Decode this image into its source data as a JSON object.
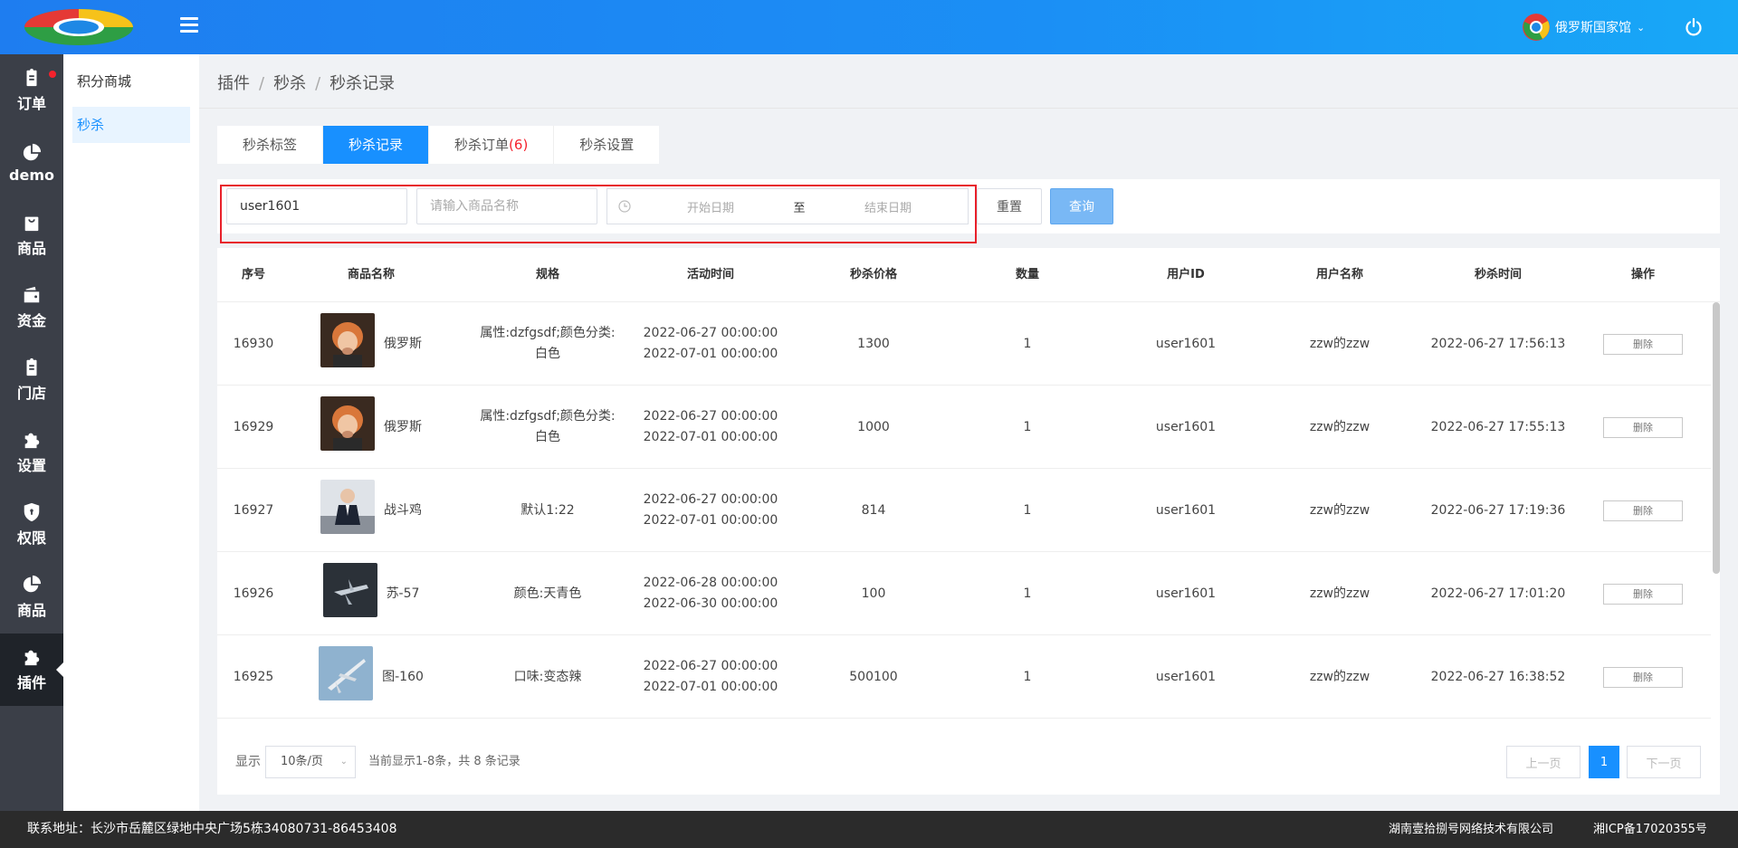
{
  "header": {
    "user_name": "俄罗斯国家馆"
  },
  "sidebar": {
    "items": [
      {
        "label": "订单",
        "icon": "clipboard-icon"
      },
      {
        "label": "demo",
        "icon": "pie-chart-icon"
      },
      {
        "label": "商品",
        "icon": "bag-icon"
      },
      {
        "label": "资金",
        "icon": "wallet-icon"
      },
      {
        "label": "门店",
        "icon": "store-icon"
      },
      {
        "label": "设置",
        "icon": "puzzle-icon"
      },
      {
        "label": "权限",
        "icon": "shield-icon"
      },
      {
        "label": "商品",
        "icon": "pie-chart-icon"
      },
      {
        "label": "插件",
        "icon": "puzzle-icon"
      }
    ]
  },
  "submenu": {
    "items": [
      "积分商城",
      "秒杀"
    ]
  },
  "breadcrumb": [
    "插件",
    "秒杀",
    "秒杀记录"
  ],
  "tabs": [
    {
      "label": "秒杀标签"
    },
    {
      "label": "秒杀记录"
    },
    {
      "label": "秒杀订单",
      "count": "(6)"
    },
    {
      "label": "秒杀设置"
    }
  ],
  "filters": {
    "user_value": "user1601",
    "product_placeholder": "请输入商品名称",
    "start_placeholder": "开始日期",
    "to_label": "至",
    "end_placeholder": "结束日期",
    "reset_label": "重置",
    "query_label": "查询"
  },
  "table": {
    "headers": [
      "序号",
      "商品名称",
      "规格",
      "活动时间",
      "秒杀价格",
      "数量",
      "用户ID",
      "用户名称",
      "秒杀时间",
      "操作"
    ],
    "delete_label": "删除",
    "rows": [
      {
        "id": "16930",
        "name": "俄罗斯",
        "spec1": "属性:dzfgsdf;颜色分类:",
        "spec2": "白色",
        "start": "2022-06-27 00:00:00",
        "end": "2022-07-01 00:00:00",
        "price": "1300",
        "qty": "1",
        "uid": "user1601",
        "uname": "zzw的zzw",
        "time": "2022-06-27 17:56:13",
        "thumb": "portrait"
      },
      {
        "id": "16929",
        "name": "俄罗斯",
        "spec1": "属性:dzfgsdf;颜色分类:",
        "spec2": "白色",
        "start": "2022-06-27 00:00:00",
        "end": "2022-07-01 00:00:00",
        "price": "1000",
        "qty": "1",
        "uid": "user1601",
        "uname": "zzw的zzw",
        "time": "2022-06-27 17:55:13",
        "thumb": "portrait"
      },
      {
        "id": "16927",
        "name": "战斗鸡",
        "spec1": "默认1:22",
        "spec2": "",
        "start": "2022-06-27 00:00:00",
        "end": "2022-07-01 00:00:00",
        "price": "814",
        "qty": "1",
        "uid": "user1601",
        "uname": "zzw的zzw",
        "time": "2022-06-27 17:19:36",
        "thumb": "suit"
      },
      {
        "id": "16926",
        "name": "苏-57",
        "spec1": "颜色:天青色",
        "spec2": "",
        "start": "2022-06-28 00:00:00",
        "end": "2022-06-30 00:00:00",
        "price": "100",
        "qty": "1",
        "uid": "user1601",
        "uname": "zzw的zzw",
        "time": "2022-06-27 17:01:20",
        "thumb": "jet"
      },
      {
        "id": "16925",
        "name": "图-160",
        "spec1": "口味:变态辣",
        "spec2": "",
        "start": "2022-06-27 00:00:00",
        "end": "2022-07-01 00:00:00",
        "price": "500100",
        "qty": "1",
        "uid": "user1601",
        "uname": "zzw的zzw",
        "time": "2022-06-27 16:38:52",
        "thumb": "bomber"
      }
    ]
  },
  "pager": {
    "show_label": "显示",
    "page_size": "10条/页",
    "summary": "当前显示1-8条，共 8 条记录",
    "prev_label": "上一页",
    "current_page": "1",
    "next_label": "下一页"
  },
  "footer": {
    "address": "联系地址：长沙市岳麓区绿地中央广场5栋34080731-86453408",
    "company": "湖南壹拾捌号网络技术有限公司",
    "icp": "湘ICP备17020355号"
  },
  "colors": {
    "primary": "#1890ff",
    "sidebar": "#3b3f48",
    "highlight": "#e8202a"
  }
}
